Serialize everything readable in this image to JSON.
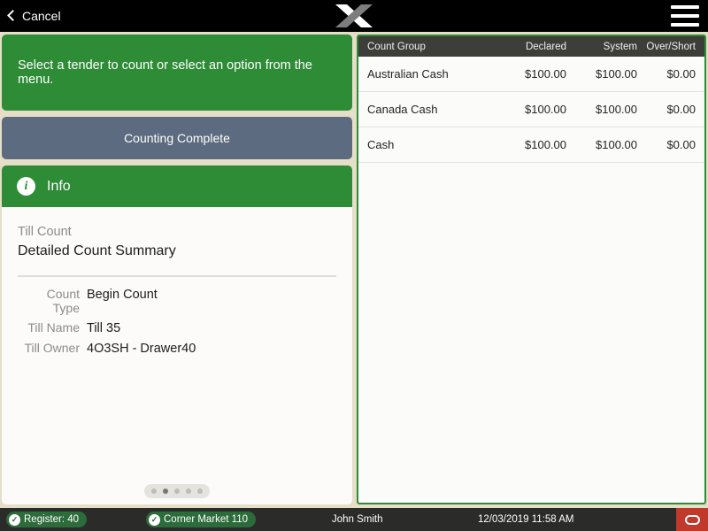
{
  "topbar": {
    "cancel_label": "Cancel",
    "back_icon": "chevron-left-icon",
    "logo_icon": "x-logo-icon",
    "menu_icon": "hamburger-menu-icon"
  },
  "left": {
    "banner_message": "Select a tender to count or select an option from the menu.",
    "counting_complete_label": "Counting Complete",
    "info": {
      "icon": "info-circle-icon",
      "icon_glyph": "i",
      "title": "Info",
      "section_label": "Till Count",
      "section_title": "Detailed Count Summary",
      "details": [
        {
          "label": "Count Type",
          "value": "Begin Count"
        },
        {
          "label": "Till Name",
          "value": "Till 35"
        },
        {
          "label": "Till Owner",
          "value": "4O3SH - Drawer40"
        }
      ]
    },
    "pager": {
      "total": 5,
      "active_index": 1
    }
  },
  "table": {
    "columns": [
      "Count Group",
      "Declared",
      "System",
      "Over/Short"
    ],
    "rows": [
      {
        "group": "Australian Cash",
        "declared": "$100.00",
        "system": "$100.00",
        "over_short": "$0.00"
      },
      {
        "group": "Canada Cash",
        "declared": "$100.00",
        "system": "$100.00",
        "over_short": "$0.00"
      },
      {
        "group": "Cash",
        "declared": "$100.00",
        "system": "$100.00",
        "over_short": "$0.00"
      }
    ]
  },
  "statusbar": {
    "register_badge": "Register: 40",
    "store_badge": "Corner Market 110",
    "badge_icon": "check-circle-icon",
    "user": "John Smith",
    "datetime": "12/03/2019 11:58 AM",
    "power_icon": "power-icon"
  },
  "colors": {
    "green": "#2e8b36",
    "slate": "#5c6b7f",
    "dark_header": "#3d3d3a",
    "status_bg": "#2b2b29",
    "badge_green": "#2c6b3a",
    "power_red": "#c0392b",
    "page_bg": "#e6dfc8"
  }
}
